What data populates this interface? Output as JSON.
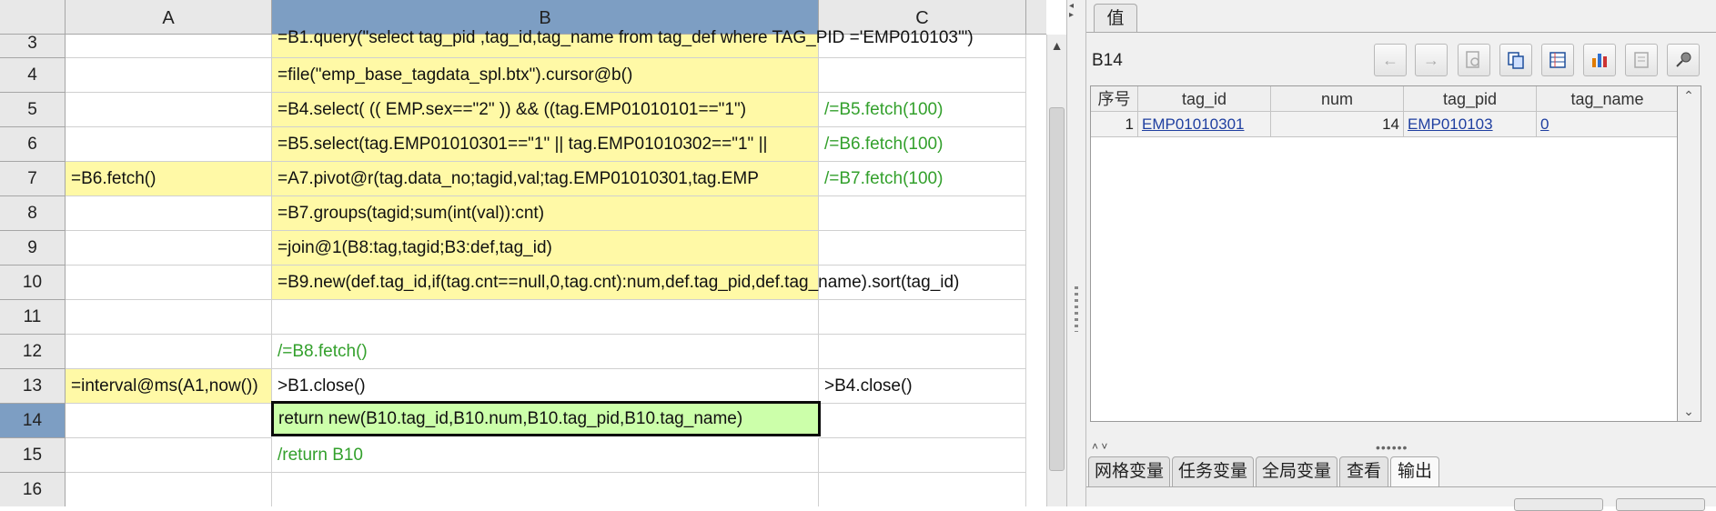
{
  "grid": {
    "columns": [
      "A",
      "B",
      "C"
    ],
    "active_column": "B",
    "rows": [
      {
        "num": "3",
        "a": "",
        "b": "=B1.query(\"select tag_pid ,tag_id,tag_name from tag_def where TAG_PID ='EMP010103'\")",
        "c": ""
      },
      {
        "num": "4",
        "a": "",
        "b": "=file(\"emp_base_tagdata_spl.btx\").cursor@b()",
        "c": ""
      },
      {
        "num": "5",
        "a": "",
        "b": "=B4.select(  (( EMP.sex==\"2\" )) &&  ((tag.EMP01010101==\"1\")",
        "c": "/=B5.fetch(100)"
      },
      {
        "num": "6",
        "a": "",
        "b": "=B5.select(tag.EMP01010301==\"1\" || tag.EMP01010302==\"1\" ||",
        "c": "/=B6.fetch(100)"
      },
      {
        "num": "7",
        "a": "=B6.fetch()",
        "b": "=A7.pivot@r(tag.data_no;tagid,val;tag.EMP01010301,tag.EMP",
        "c": "/=B7.fetch(100)"
      },
      {
        "num": "8",
        "a": "",
        "b": "=B7.groups(tagid;sum(int(val)):cnt)",
        "c": ""
      },
      {
        "num": "9",
        "a": "",
        "b": "=join@1(B8:tag,tagid;B3:def,tag_id)",
        "c": ""
      },
      {
        "num": "10",
        "a": "",
        "b": "=B9.new(def.tag_id,if(tag.cnt==null,0,tag.cnt):num,def.tag_pid,def.tag_name).sort(tag_id)",
        "c": ""
      },
      {
        "num": "11",
        "a": "",
        "b": "",
        "c": ""
      },
      {
        "num": "12",
        "a": "",
        "b": "/=B8.fetch()",
        "c": ""
      },
      {
        "num": "13",
        "a": "=interval@ms(A1,now())",
        "b": ">B1.close()",
        "c": ">B4.close()"
      },
      {
        "num": "14",
        "a": "",
        "b": "return new(B10.tag_id,B10.num,B10.tag_pid,B10.tag_name)",
        "c": ""
      },
      {
        "num": "15",
        "a": "",
        "b": "/return B10",
        "c": ""
      },
      {
        "num": "16",
        "a": "",
        "b": "",
        "c": ""
      }
    ]
  },
  "panel": {
    "tab_value": "值",
    "cell_ref": "B14",
    "toolbar": [
      {
        "icon": "arrow-left-icon"
      },
      {
        "icon": "arrow-right-icon"
      },
      {
        "icon": "search-doc-icon"
      },
      {
        "icon": "copy-icon"
      },
      {
        "icon": "table-view-icon"
      },
      {
        "icon": "bar-chart-icon"
      },
      {
        "icon": "settings-doc-icon"
      },
      {
        "icon": "pin-icon"
      }
    ],
    "table": {
      "headers": [
        "序号",
        "tag_id",
        "num",
        "tag_pid",
        "tag_name"
      ],
      "rows": [
        {
          "idx": "1",
          "tag_id": "EMP01010301",
          "num": "14",
          "tag_pid": "EMP010103",
          "tag_name": "0"
        }
      ]
    },
    "bottom_tabs": [
      "网格变量",
      "任务变量",
      "全局变量",
      "查看",
      "输出"
    ],
    "active_bottom_tab": "输出"
  },
  "colors": {
    "formula_cell": "#fff9a6",
    "selected_cell": "#ccffaa",
    "comment_text": "#33a02c",
    "header_active": "#7d9ec3",
    "link": "#1f3fa0"
  }
}
